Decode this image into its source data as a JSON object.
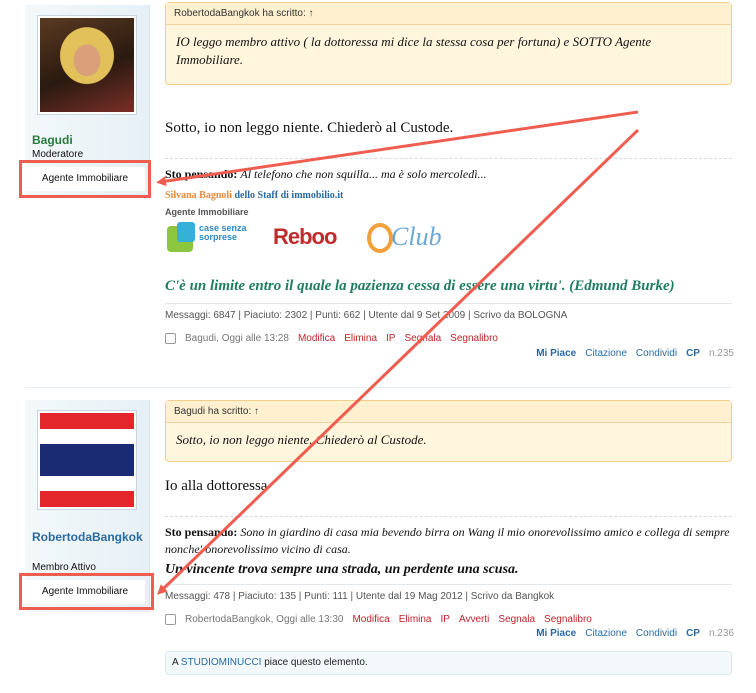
{
  "colors": {
    "annotation_red": "#ee5d50",
    "link_blue": "#2a6aa0",
    "action_red": "#c2232a",
    "quote_bg": "#fff6dd"
  },
  "post1": {
    "user": {
      "name": "Bagudi",
      "title": "Moderatore",
      "role": "Agente Immobiliare",
      "avatar": "user-photo"
    },
    "quote": {
      "header": "RobertodaBangkok ha scritto: ↑",
      "text": "IO leggo membro attivo ( la dottoressa mi dice la stessa cosa per fortuna) e SOTTO Agente Immobiliare."
    },
    "message": "Sotto, io non leggo niente. Chiederò al Custode.",
    "thinking_label": "Sto pensando:",
    "thinking_text": "Al telefono che non squilla... ma è solo mercoledì...",
    "staff_name": "Silvana Bagnoli",
    "staff_rest": "dello Staff di immobilio.it",
    "agent_label": "Agente Immobiliare",
    "logos": {
      "case": "case senza sorprese",
      "reboo": "Reboo",
      "club": "Club"
    },
    "motto": "C'è un limite entro il quale la pazienza cessa di essere una virtu'. (Edmund Burke)",
    "stats": "Messaggi: 6847 | Piaciuto: 2302 | Punti: 662 | Utente dal 9 Set 2009 | Scrivo da BOLOGNA",
    "meta": "Bagudi, Oggi alle 13:28",
    "actions": [
      "Modifica",
      "Elimina",
      "IP",
      "Segnala",
      "Segnalibro"
    ],
    "links": [
      "Mi Piace",
      "Citazione",
      "Condividi",
      "CP"
    ],
    "number": "n.235"
  },
  "post2": {
    "user": {
      "name": "RobertodaBangkok",
      "title": "Membro Attivo",
      "role": "Agente Immobiliare",
      "avatar": "thai-flag"
    },
    "quote": {
      "header": "Bagudi ha scritto: ↑",
      "text": "Sotto, io non leggo niente. Chiederò al Custode."
    },
    "message": "Io alla dottoressa",
    "thinking_label": "Sto pensando:",
    "thinking_text": "Sono in giardino di casa mia bevendo birra on Wang il mio onorevolissimo amico e collega di sempre nonche' onorevolissimo vicino di casa.",
    "motto": "Un vincente trova sempre una strada, un perdente una scusa.",
    "stats": "Messaggi: 478 | Piaciuto: 135 | Punti: 111 | Utente dal 19 Mag 2012 | Scrivo da Bangkok",
    "meta": "RobertodaBangkok, Oggi alle 13:30",
    "actions": [
      "Modifica",
      "Elimina",
      "IP",
      "Avverti",
      "Segnala",
      "Segnalibro"
    ],
    "links": [
      "Mi Piace",
      "Citazione",
      "Condividi",
      "CP"
    ],
    "number": "n.236",
    "likes_prefix": "A",
    "likes_user": "STUDIOMINUCCI",
    "likes_suffix": "piace questo elemento."
  }
}
